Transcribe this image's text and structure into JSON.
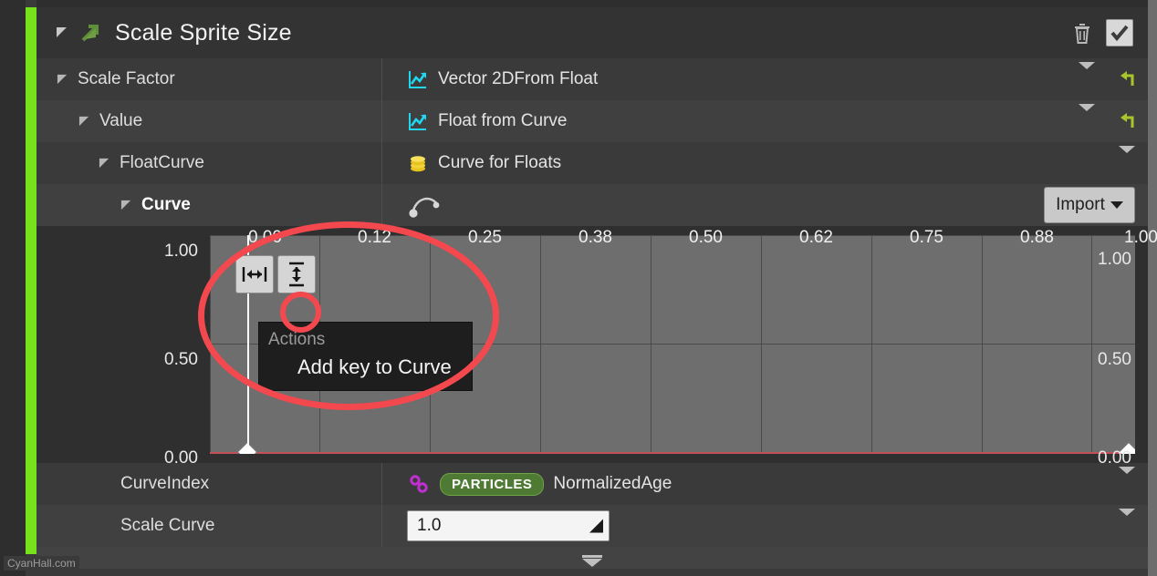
{
  "header": {
    "title": "Scale Sprite Size",
    "expand_icon": "expand-triangle-icon",
    "module_icon": "green-arrow-icon",
    "delete_icon": "trash-icon",
    "enabled_checkbox": "checked-checkbox-icon"
  },
  "rows": [
    {
      "label": "Scale Factor",
      "value": "Vector 2DFrom Float",
      "icon": "curve-chart-icon",
      "has_reset": true,
      "has_chevron": true,
      "indent": 0
    },
    {
      "label": "Value",
      "value": "Float from Curve",
      "icon": "curve-chart-icon",
      "has_reset": true,
      "has_chevron": true,
      "indent": 1
    },
    {
      "label": "FloatCurve",
      "value": "Curve for Floats",
      "icon": "stacked-coins-icon",
      "has_reset": false,
      "has_chevron": true,
      "indent": 2
    },
    {
      "label": "Curve",
      "value": "",
      "icon": "curve-keys-icon",
      "has_reset": false,
      "has_chevron": false,
      "indent": 3
    }
  ],
  "import_button": {
    "label": "Import",
    "caret": "chevron-down-icon"
  },
  "graph": {
    "fit_horizontal_icon": "fit-horizontal-icon",
    "fit_vertical_icon": "fit-vertical-icon",
    "x_ticks": [
      "0.00",
      "0.12",
      "0.25",
      "0.38",
      "0.50",
      "0.62",
      "0.75",
      "0.88",
      "1.00"
    ],
    "y_ticks_left": [
      "1.00",
      "0.50",
      "0.00"
    ],
    "y_ticks_right": [
      "1.00",
      "0.50",
      "0.00"
    ],
    "curve_color": "#c4505a",
    "key_count": 2
  },
  "chart_data": {
    "type": "line",
    "title": "Curve",
    "xlabel": "",
    "ylabel": "",
    "xlim": [
      0.0,
      1.0
    ],
    "ylim": [
      0.0,
      1.0
    ],
    "x_ticks": [
      0.0,
      0.12,
      0.25,
      0.38,
      0.5,
      0.62,
      0.75,
      0.88,
      1.0
    ],
    "y_ticks": [
      0.0,
      0.5,
      1.0
    ],
    "grid": true,
    "legend": "none",
    "series": [
      {
        "name": "FloatCurve",
        "x": [
          0.0,
          1.0
        ],
        "values": [
          0.0,
          0.0
        ],
        "color": "#c4505a",
        "keys": [
          [
            0.0,
            0.0
          ],
          [
            1.0,
            0.0
          ]
        ]
      }
    ]
  },
  "context_menu": {
    "header": "Actions",
    "item": "Add key to Curve"
  },
  "bottom_rows": [
    {
      "label": "CurveIndex",
      "badge": "PARTICLES",
      "value": "NormalizedAge",
      "icon": "link-chain-icon"
    },
    {
      "label": "Scale Curve",
      "input_value": "1.0",
      "badge": "",
      "value": ""
    }
  ],
  "footer": {
    "collapse_icon": "collapse-chevron-icon"
  },
  "watermark": "CyanHall.com",
  "colors": {
    "accent_green": "#76e21c",
    "curve_red": "#c4505a",
    "annotation_red": "#f4484f",
    "badge_green": "#4f7a34"
  }
}
